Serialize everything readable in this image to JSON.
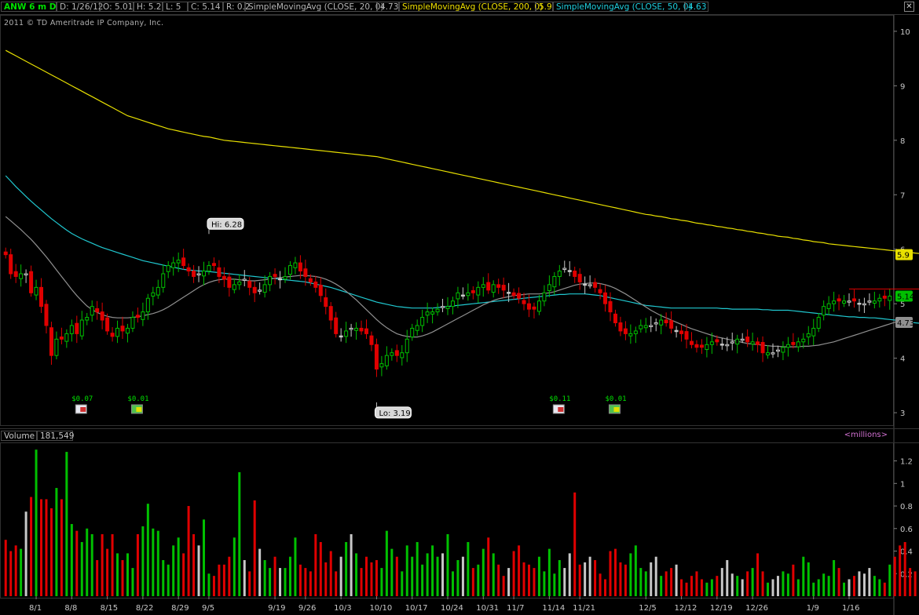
{
  "header": {
    "symbol": "ANW 6 m D",
    "date": "D: 1/26/12",
    "open": "O: 5.01",
    "high": "H: 5.2",
    "low": "L: 5",
    "close": "C: 5.14",
    "range": "R: 0.2",
    "sma20_label": "SimpleMovingAvg (CLOSE, 20, 0)",
    "sma20_value": "4.73",
    "sma200_label": "SimpleMovingAvg (CLOSE, 200, 0)",
    "sma200_value": "5.9",
    "sma50_label": "SimpleMovingAvg (CLOSE, 50, 0)",
    "sma50_value": "4.63"
  },
  "copyright": "2011 © TD Ameritrade IP Company, Inc.",
  "volume_header": {
    "label": "Volume",
    "value": "181,549",
    "units": "<millions>"
  },
  "colors": {
    "up": "#00c000",
    "down": "#e00000",
    "neutral": "#c8c8c8",
    "sma200": "#e8e000",
    "sma50": "#20c8d0",
    "sma20": "#909090"
  },
  "chart_data": [
    {
      "type": "candlestick",
      "title": "ANW 6 m D",
      "ylim": [
        2.8,
        10.2
      ],
      "y_ticks": [
        3,
        4,
        5,
        6,
        7,
        8,
        9,
        10
      ],
      "price_labels": {
        "sma200": "5.9",
        "close": "5.14",
        "sma20": "4.73"
      },
      "annotations": [
        {
          "text": "Hi: 6.28",
          "index": 40,
          "value": 6.28
        },
        {
          "text": "Lo: 3.19",
          "index": 73,
          "value": 3.19
        }
      ],
      "dividends": [
        {
          "text": "$0.07",
          "index": 15
        },
        {
          "text": "$0.01",
          "index": 26
        },
        {
          "text": "$0.11",
          "index": 109
        },
        {
          "text": "$0.01",
          "index": 120
        }
      ],
      "resistance": {
        "value": 5.27,
        "from_index": 166,
        "to_index": 185
      },
      "close": [
        5.9,
        5.55,
        5.5,
        5.55,
        5.55,
        5.2,
        5.3,
        4.95,
        4.6,
        4.05,
        4.35,
        4.35,
        4.45,
        4.6,
        4.45,
        4.7,
        4.75,
        4.95,
        4.85,
        4.7,
        4.5,
        4.4,
        4.55,
        4.5,
        4.55,
        4.75,
        4.75,
        4.85,
        5.1,
        5.2,
        5.3,
        5.55,
        5.7,
        5.75,
        5.8,
        5.7,
        5.6,
        5.5,
        5.55,
        5.6,
        5.7,
        5.7,
        5.5,
        5.45,
        5.3,
        5.35,
        5.4,
        5.45,
        5.3,
        5.2,
        5.25,
        5.35,
        5.5,
        5.5,
        5.45,
        5.5,
        5.7,
        5.75,
        5.6,
        5.5,
        5.4,
        5.3,
        5.15,
        4.95,
        4.7,
        4.45,
        4.4,
        4.5,
        4.55,
        4.55,
        4.5,
        4.45,
        4.25,
        3.8,
        3.9,
        4.05,
        4.1,
        4.05,
        4.1,
        4.35,
        4.55,
        4.6,
        4.75,
        4.85,
        4.85,
        4.9,
        4.95,
        4.95,
        5.05,
        5.2,
        5.15,
        5.2,
        5.2,
        5.3,
        5.35,
        5.25,
        5.35,
        5.3,
        5.25,
        5.2,
        5.15,
        5.1,
        5.0,
        4.9,
        4.9,
        5.05,
        5.2,
        5.35,
        5.5,
        5.6,
        5.65,
        5.6,
        5.5,
        5.4,
        5.35,
        5.35,
        5.3,
        5.2,
        5.0,
        4.85,
        4.65,
        4.5,
        4.45,
        4.45,
        4.5,
        4.6,
        4.6,
        4.6,
        4.65,
        4.7,
        4.65,
        4.55,
        4.5,
        4.45,
        4.35,
        4.25,
        4.2,
        4.2,
        4.25,
        4.3,
        4.3,
        4.25,
        4.25,
        4.3,
        4.35,
        4.35,
        4.3,
        4.3,
        4.25,
        4.1,
        4.1,
        4.1,
        4.15,
        4.2,
        4.25,
        4.25,
        4.3,
        4.35,
        4.45,
        4.55,
        4.75,
        4.95,
        5.0,
        5.05,
        5.05,
        5.05,
        5.05,
        5.05,
        5.0,
        5.0,
        5.05,
        5.05,
        5.1,
        5.1,
        5.14
      ],
      "sma200": [
        9.65,
        9.6,
        9.55,
        9.5,
        9.45,
        9.4,
        9.35,
        9.3,
        9.25,
        9.2,
        9.15,
        9.1,
        9.05,
        9.0,
        8.95,
        8.9,
        8.85,
        8.8,
        8.75,
        8.7,
        8.65,
        8.6,
        8.55,
        8.5,
        8.45,
        8.42,
        8.39,
        8.36,
        8.33,
        8.3,
        8.27,
        8.24,
        8.21,
        8.19,
        8.17,
        8.15,
        8.13,
        8.11,
        8.09,
        8.07,
        8.06,
        8.04,
        8.02,
        8.0,
        7.99,
        7.98,
        7.97,
        7.96,
        7.95,
        7.94,
        7.93,
        7.92,
        7.91,
        7.9,
        7.89,
        7.88,
        7.87,
        7.86,
        7.85,
        7.84,
        7.83,
        7.82,
        7.81,
        7.8,
        7.79,
        7.78,
        7.77,
        7.76,
        7.75,
        7.74,
        7.73,
        7.72,
        7.71,
        7.7,
        7.68,
        7.66,
        7.64,
        7.62,
        7.6,
        7.58,
        7.56,
        7.54,
        7.52,
        7.5,
        7.48,
        7.46,
        7.44,
        7.42,
        7.4,
        7.38,
        7.36,
        7.34,
        7.32,
        7.3,
        7.28,
        7.26,
        7.24,
        7.22,
        7.2,
        7.18,
        7.16,
        7.14,
        7.12,
        7.1,
        7.08,
        7.06,
        7.04,
        7.02,
        7.0,
        6.98,
        6.96,
        6.94,
        6.92,
        6.9,
        6.88,
        6.86,
        6.84,
        6.82,
        6.8,
        6.78,
        6.76,
        6.74,
        6.72,
        6.7,
        6.68,
        6.66,
        6.64,
        6.63,
        6.61,
        6.6,
        6.58,
        6.56,
        6.55,
        6.53,
        6.52,
        6.5,
        6.48,
        6.47,
        6.45,
        6.44,
        6.42,
        6.41,
        6.39,
        6.38,
        6.36,
        6.35,
        6.33,
        6.32,
        6.3,
        6.29,
        6.27,
        6.26,
        6.24,
        6.23,
        6.22,
        6.2,
        6.19,
        6.17,
        6.16,
        6.14,
        6.13,
        6.12,
        6.1,
        6.09,
        6.08,
        6.07,
        6.06,
        6.05,
        6.04,
        6.03,
        6.02,
        6.01,
        6.0,
        5.99,
        5.98,
        5.97,
        5.96,
        5.95,
        5.94,
        5.93,
        5.92,
        5.91,
        5.9
      ],
      "sma50": [
        7.35,
        7.25,
        7.15,
        7.06,
        6.97,
        6.88,
        6.8,
        6.72,
        6.64,
        6.56,
        6.49,
        6.42,
        6.35,
        6.29,
        6.24,
        6.19,
        6.15,
        6.11,
        6.07,
        6.03,
        6.0,
        5.97,
        5.94,
        5.91,
        5.88,
        5.85,
        5.82,
        5.79,
        5.77,
        5.75,
        5.73,
        5.71,
        5.69,
        5.67,
        5.65,
        5.63,
        5.62,
        5.61,
        5.6,
        5.6,
        5.59,
        5.58,
        5.57,
        5.56,
        5.55,
        5.54,
        5.53,
        5.52,
        5.51,
        5.5,
        5.49,
        5.48,
        5.47,
        5.46,
        5.45,
        5.44,
        5.43,
        5.42,
        5.41,
        5.4,
        5.38,
        5.36,
        5.34,
        5.32,
        5.3,
        5.27,
        5.24,
        5.21,
        5.18,
        5.15,
        5.12,
        5.09,
        5.06,
        5.03,
        5.01,
        4.99,
        4.97,
        4.95,
        4.94,
        4.93,
        4.92,
        4.92,
        4.92,
        4.92,
        4.92,
        4.93,
        4.94,
        4.95,
        4.96,
        4.97,
        4.98,
        4.99,
        5.0,
        5.01,
        5.02,
        5.03,
        5.04,
        5.05,
        5.06,
        5.07,
        5.08,
        5.09,
        5.1,
        5.11,
        5.12,
        5.13,
        5.14,
        5.15,
        5.16,
        5.17,
        5.17,
        5.18,
        5.18,
        5.18,
        5.18,
        5.17,
        5.16,
        5.15,
        5.13,
        5.11,
        5.09,
        5.07,
        5.05,
        5.03,
        5.01,
        4.99,
        4.97,
        4.96,
        4.95,
        4.94,
        4.93,
        4.92,
        4.92,
        4.92,
        4.92,
        4.92,
        4.92,
        4.92,
        4.92,
        4.92,
        4.92,
        4.91,
        4.91,
        4.9,
        4.9,
        4.9,
        4.9,
        4.9,
        4.9,
        4.89,
        4.89,
        4.88,
        4.88,
        4.88,
        4.88,
        4.87,
        4.86,
        4.85,
        4.84,
        4.83,
        4.82,
        4.81,
        4.8,
        4.79,
        4.78,
        4.77,
        4.76,
        4.76,
        4.75,
        4.75,
        4.74,
        4.74,
        4.73,
        4.72,
        4.71,
        4.7,
        4.69,
        4.68,
        4.66,
        4.65,
        4.64,
        4.63
      ],
      "sma20": [
        6.6,
        6.52,
        6.44,
        6.36,
        6.27,
        6.18,
        6.08,
        5.97,
        5.86,
        5.74,
        5.62,
        5.5,
        5.38,
        5.26,
        5.15,
        5.05,
        4.96,
        4.89,
        4.84,
        4.8,
        4.77,
        4.75,
        4.74,
        4.74,
        4.74,
        4.75,
        4.76,
        4.78,
        4.8,
        4.82,
        4.85,
        4.89,
        4.94,
        5.0,
        5.06,
        5.12,
        5.18,
        5.24,
        5.3,
        5.35,
        5.39,
        5.42,
        5.44,
        5.45,
        5.45,
        5.45,
        5.44,
        5.43,
        5.42,
        5.42,
        5.43,
        5.44,
        5.45,
        5.47,
        5.48,
        5.49,
        5.5,
        5.51,
        5.52,
        5.52,
        5.51,
        5.5,
        5.48,
        5.45,
        5.41,
        5.36,
        5.3,
        5.23,
        5.15,
        5.07,
        4.98,
        4.89,
        4.8,
        4.71,
        4.63,
        4.56,
        4.5,
        4.45,
        4.42,
        4.4,
        4.39,
        4.39,
        4.41,
        4.44,
        4.48,
        4.53,
        4.58,
        4.63,
        4.68,
        4.73,
        4.78,
        4.83,
        4.88,
        4.93,
        4.98,
        5.02,
        5.06,
        5.09,
        5.11,
        5.13,
        5.15,
        5.16,
        5.17,
        5.18,
        5.18,
        5.18,
        5.19,
        5.2,
        5.22,
        5.25,
        5.28,
        5.31,
        5.34,
        5.36,
        5.37,
        5.38,
        5.38,
        5.37,
        5.35,
        5.32,
        5.28,
        5.23,
        5.18,
        5.12,
        5.06,
        5.0,
        4.94,
        4.88,
        4.83,
        4.78,
        4.74,
        4.7,
        4.66,
        4.62,
        4.58,
        4.54,
        4.51,
        4.48,
        4.45,
        4.42,
        4.39,
        4.37,
        4.35,
        4.33,
        4.31,
        4.29,
        4.27,
        4.26,
        4.25,
        4.24,
        4.23,
        4.22,
        4.22,
        4.21,
        4.21,
        4.21,
        4.21,
        4.22,
        4.22,
        4.23,
        4.24,
        4.26,
        4.28,
        4.3,
        4.33,
        4.36,
        4.39,
        4.42,
        4.45,
        4.48,
        4.51,
        4.54,
        4.57,
        4.6,
        4.63,
        4.66,
        4.69,
        4.71,
        4.73
      ]
    },
    {
      "type": "bar",
      "title": "Volume",
      "ylim": [
        0,
        1.35
      ],
      "y_ticks": [
        0.2,
        0.4,
        0.6,
        0.8,
        1,
        1.2
      ],
      "x_tick_labels": [
        {
          "text": "8/1",
          "index": 6
        },
        {
          "text": "8/8",
          "index": 13
        },
        {
          "text": "8/15",
          "index": 20
        },
        {
          "text": "8/22",
          "index": 27
        },
        {
          "text": "8/29",
          "index": 34
        },
        {
          "text": "9/5",
          "index": 40
        },
        {
          "text": "9/19",
          "index": 53
        },
        {
          "text": "9/26",
          "index": 59
        },
        {
          "text": "10/3",
          "index": 66
        },
        {
          "text": "10/10",
          "index": 73
        },
        {
          "text": "10/17",
          "index": 80
        },
        {
          "text": "10/24",
          "index": 87
        },
        {
          "text": "10/31",
          "index": 94
        },
        {
          "text": "11/7",
          "index": 100
        },
        {
          "text": "11/14",
          "index": 107
        },
        {
          "text": "11/21",
          "index": 113
        },
        {
          "text": "12/5",
          "index": 126
        },
        {
          "text": "12/12",
          "index": 133
        },
        {
          "text": "12/19",
          "index": 140
        },
        {
          "text": "12/26",
          "index": 147
        },
        {
          "text": "1/9",
          "index": 159
        },
        {
          "text": "1/16",
          "index": 166
        }
      ],
      "values": [
        0.5,
        0.4,
        0.45,
        0.42,
        0.75,
        0.88,
        1.3,
        0.86,
        0.86,
        0.78,
        0.96,
        0.86,
        1.28,
        0.64,
        0.58,
        0.48,
        0.6,
        0.55,
        0.32,
        0.55,
        0.42,
        0.55,
        0.38,
        0.32,
        0.38,
        0.25,
        0.55,
        0.62,
        0.82,
        0.6,
        0.58,
        0.32,
        0.28,
        0.45,
        0.52,
        0.38,
        0.8,
        0.55,
        0.45,
        0.68,
        0.2,
        0.18,
        0.28,
        0.28,
        0.35,
        0.52,
        1.1,
        0.32,
        0.22,
        0.85,
        0.42,
        0.32,
        0.25,
        0.35,
        0.25,
        0.25,
        0.35,
        0.52,
        0.28,
        0.25,
        0.22,
        0.55,
        0.48,
        0.3,
        0.4,
        0.22,
        0.35,
        0.48,
        0.55,
        0.38,
        0.25,
        0.35,
        0.3,
        0.32,
        0.25,
        0.58,
        0.42,
        0.35,
        0.22,
        0.45,
        0.35,
        0.48,
        0.28,
        0.38,
        0.45,
        0.35,
        0.38,
        0.55,
        0.22,
        0.32,
        0.35,
        0.48,
        0.25,
        0.28,
        0.42,
        0.52,
        0.38,
        0.28,
        0.18,
        0.25,
        0.4,
        0.45,
        0.3,
        0.28,
        0.25,
        0.35,
        0.22,
        0.42,
        0.2,
        0.32,
        0.25,
        0.38,
        0.92,
        0.28,
        0.3,
        0.35,
        0.32,
        0.2,
        0.15,
        0.4,
        0.42,
        0.3,
        0.28,
        0.38,
        0.45,
        0.25,
        0.22,
        0.3,
        0.35,
        0.18,
        0.22,
        0.25,
        0.28,
        0.15,
        0.12,
        0.18,
        0.22,
        0.15,
        0.12,
        0.15,
        0.18,
        0.25,
        0.32,
        0.2,
        0.18,
        0.15,
        0.22,
        0.25,
        0.38,
        0.22,
        0.12,
        0.15,
        0.18,
        0.22,
        0.2,
        0.28,
        0.15,
        0.35,
        0.3,
        0.12,
        0.15,
        0.2,
        0.18,
        0.32,
        0.25,
        0.12,
        0.15,
        0.18,
        0.22,
        0.2,
        0.25,
        0.18,
        0.15,
        0.12,
        0.28,
        0.35,
        0.45,
        0.48,
        0.25,
        0.22,
        0.18
      ]
    }
  ]
}
